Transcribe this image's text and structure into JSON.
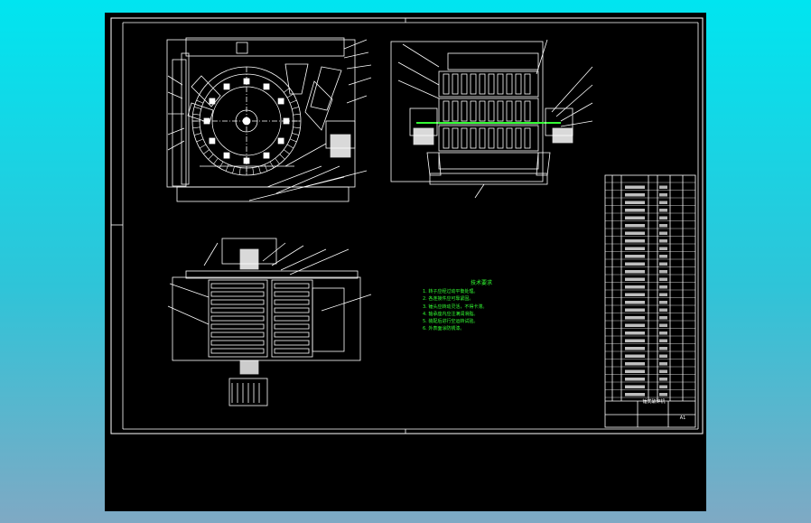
{
  "colors": {
    "background_top": "#00e5f0",
    "background_bottom": "#7fa9c4",
    "canvas": "#000000",
    "line": "#ffffff",
    "notes_text": "#33ff33"
  },
  "notes": {
    "title": "技术要求",
    "items": [
      "1. 转子应经过动平衡处理。",
      "2. 各连接件应可靠紧固。",
      "3. 锤头应转动灵活，不得卡滞。",
      "4. 轴承座内应注满润滑脂。",
      "5. 装配后进行空运转试验。",
      "6. 外表面涂防锈漆。"
    ]
  },
  "title_block": {
    "name": "锤式破碎机",
    "sheet": "A1"
  }
}
